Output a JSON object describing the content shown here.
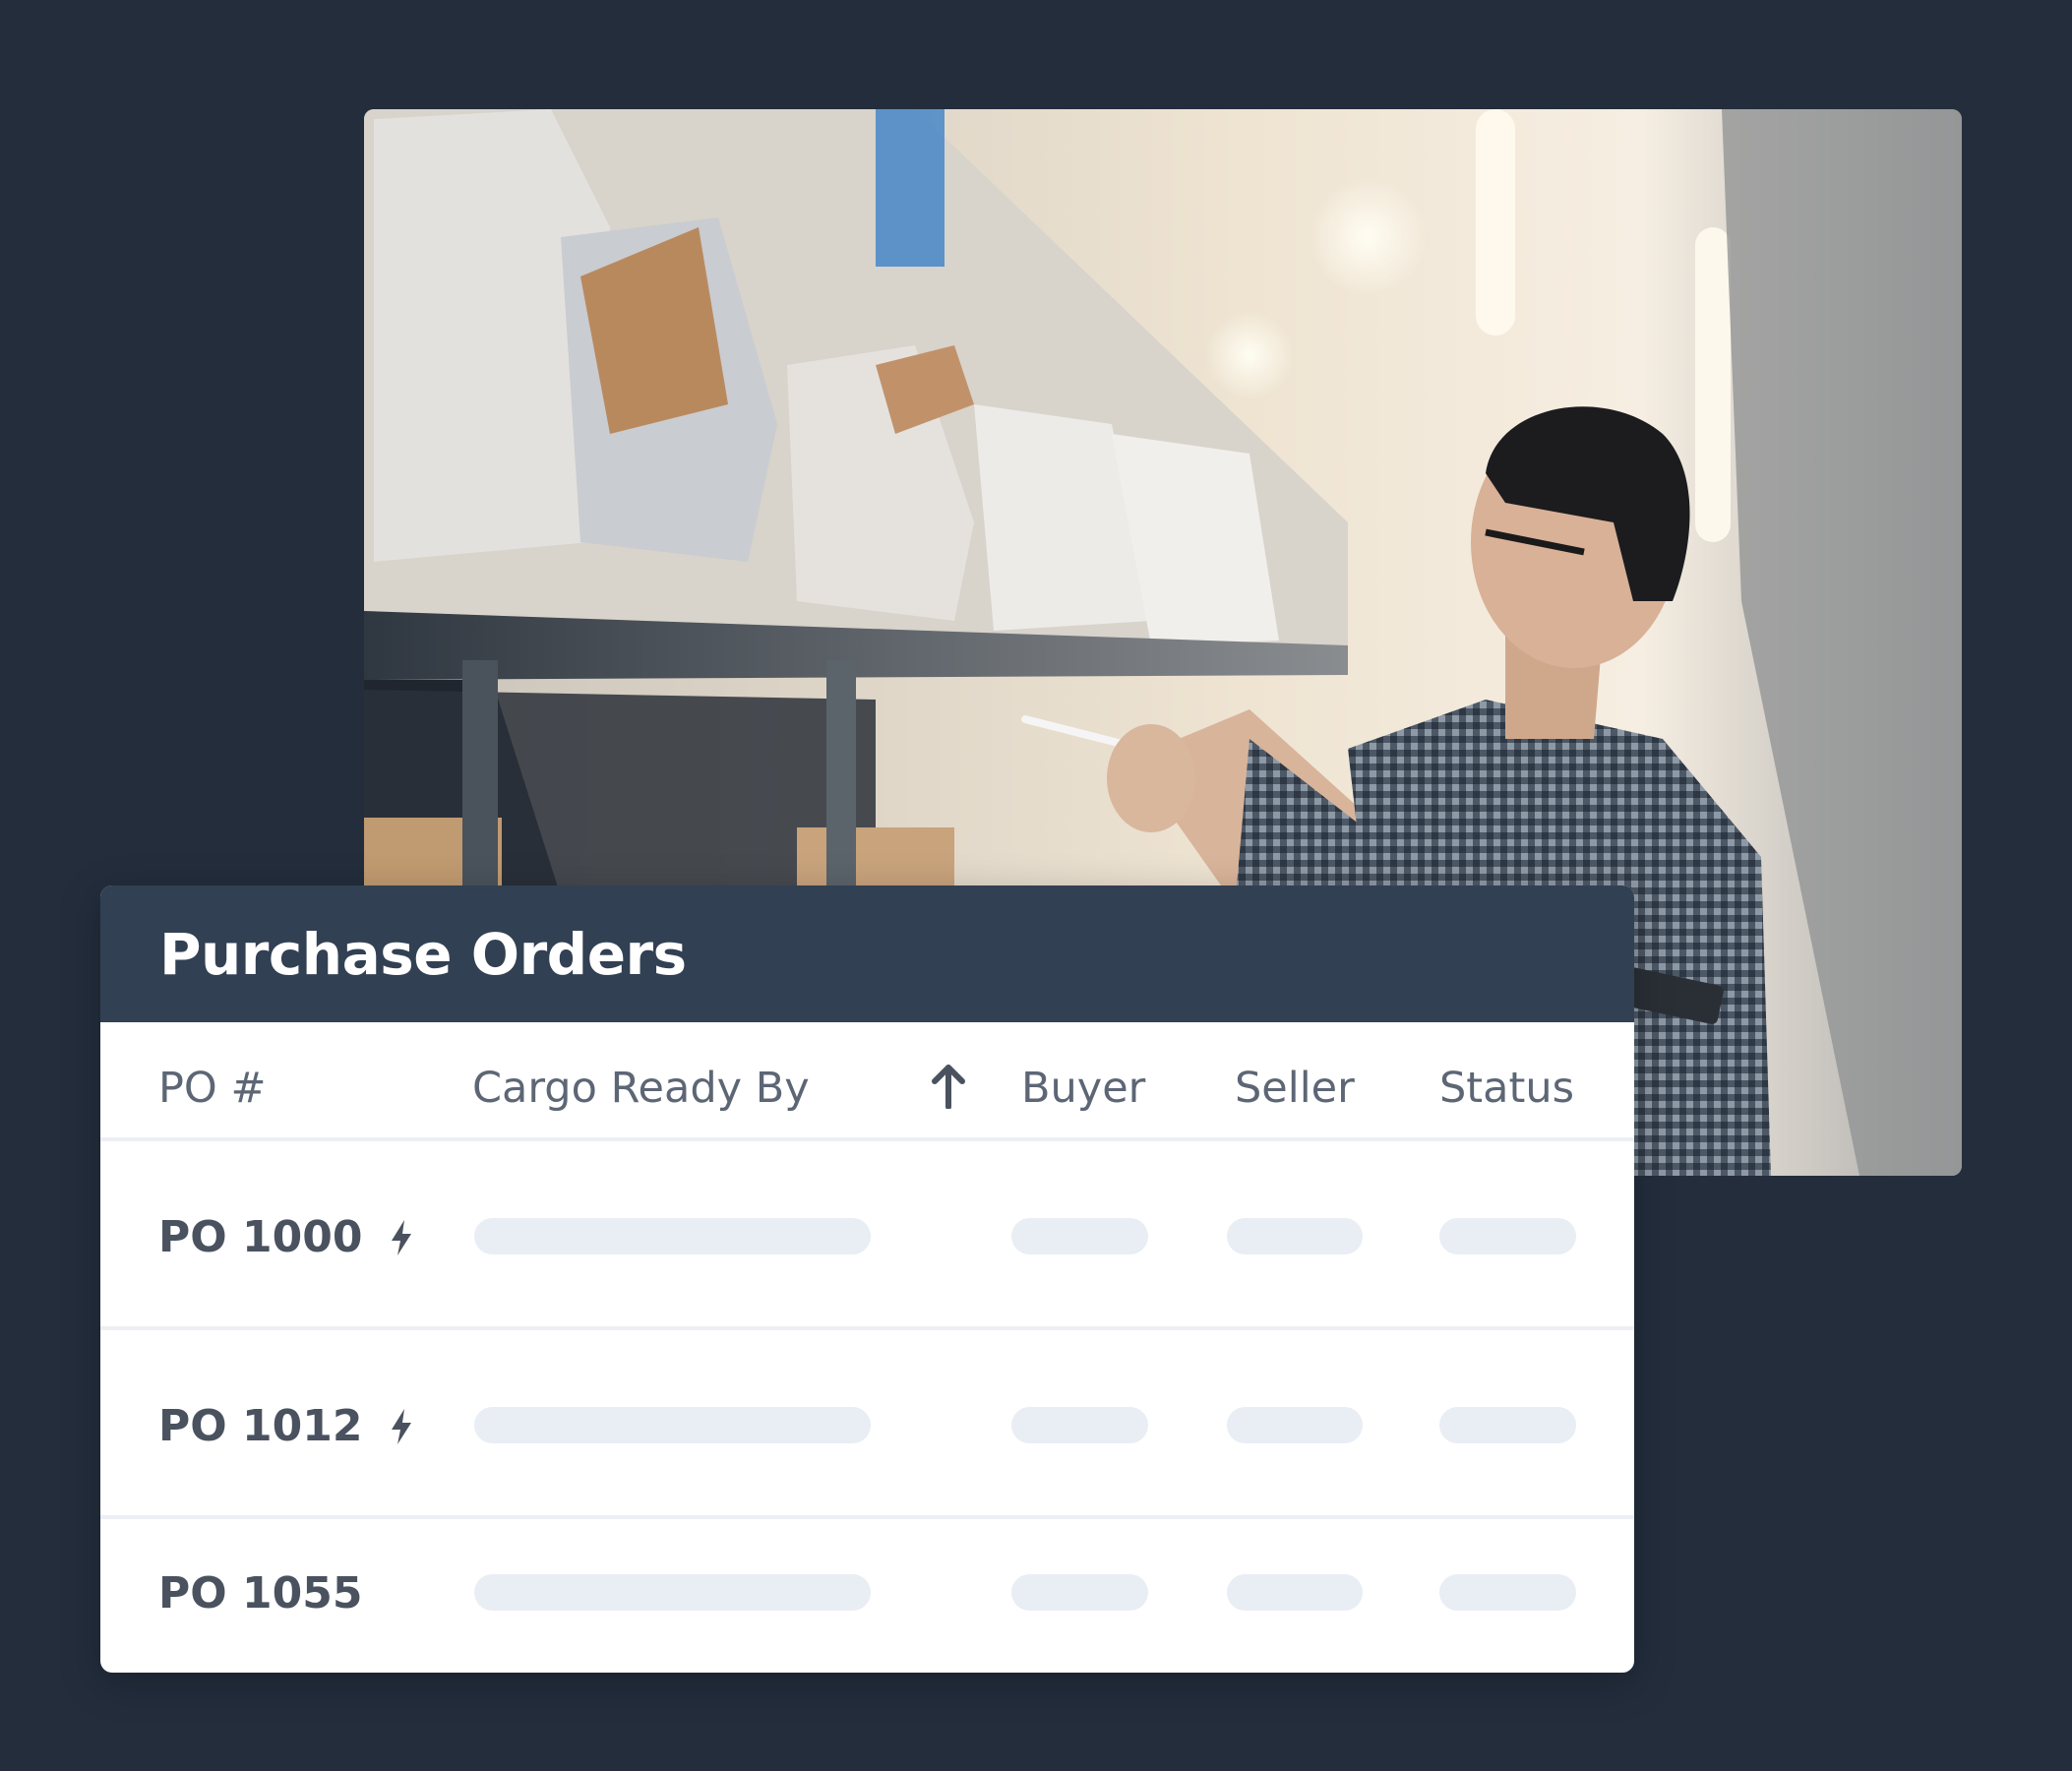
{
  "photo": {
    "description_icon": "warehouse-photo"
  },
  "card": {
    "title": "Purchase Orders",
    "columns": {
      "po": "PO #",
      "cargo": "Cargo Ready By",
      "buyer": "Buyer",
      "seller": "Seller",
      "status": "Status"
    },
    "sort_icon": "arrow-up-icon",
    "rows": [
      {
        "po": "PO 1000",
        "priority": true
      },
      {
        "po": "PO 1012",
        "priority": true
      },
      {
        "po": "PO 1055",
        "priority": false
      }
    ]
  },
  "colors": {
    "background": "#232d3c",
    "header": "#324053",
    "placeholder": "#e9edf4",
    "text": "#4a525f"
  }
}
